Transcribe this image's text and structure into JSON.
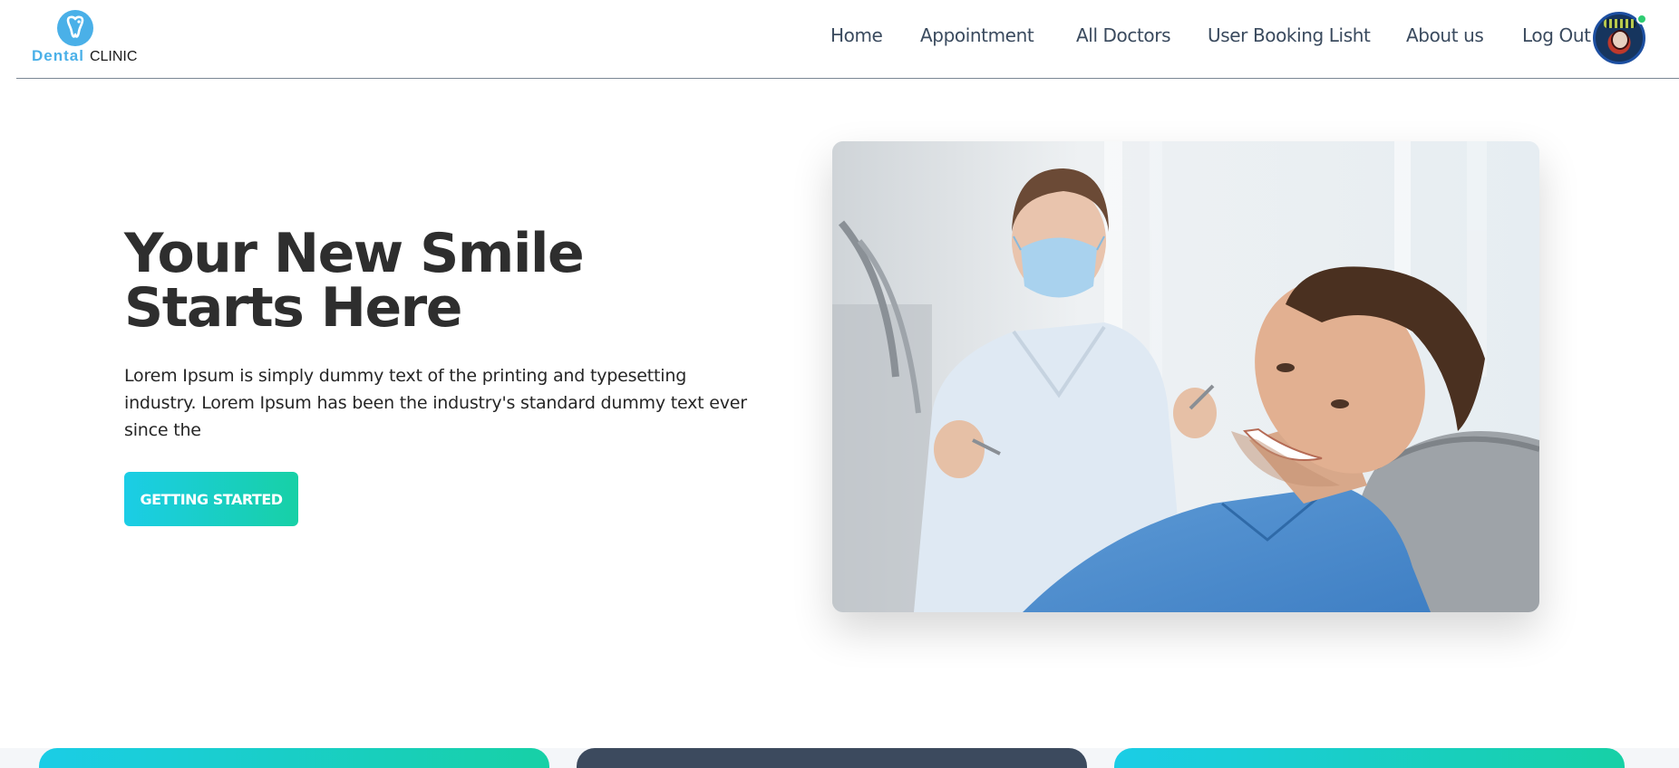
{
  "brand": {
    "name_primary": "Dental",
    "name_secondary": "CLINIC",
    "color_primary": "#4ab0e8"
  },
  "nav": {
    "items": [
      {
        "label": "Home"
      },
      {
        "label": "Appointment"
      },
      {
        "label": "All Doctors"
      },
      {
        "label": "User Booking Lisht"
      },
      {
        "label": "About us"
      },
      {
        "label": "Log Out"
      }
    ]
  },
  "user": {
    "avatar_icon": "user-avatar",
    "status": "online",
    "status_color": "#2ecc71"
  },
  "hero": {
    "title": "Your New Smile Starts Here",
    "description": "Lorem Ipsum is simply dummy text of the printing and typesetting industry. Lorem Ipsum has been the industry's standard dummy text ever since the",
    "cta_label": "GETTING STARTED",
    "accent_gradient": [
      "#1bcde6",
      "#17d0a6"
    ]
  },
  "cards": {
    "colors": [
      "#1bcde6",
      "#3c4a5e",
      "#1bcde6"
    ]
  }
}
